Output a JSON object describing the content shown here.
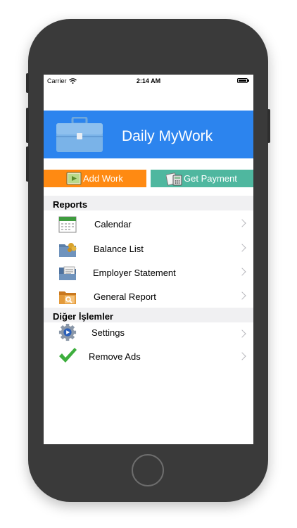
{
  "status_bar": {
    "carrier": "Carrier",
    "time": "2:14 AM"
  },
  "header": {
    "title": "Daily MyWork"
  },
  "actions": {
    "add_work": "Add Work",
    "get_payment": "Get Payment"
  },
  "reports": {
    "heading": "Reports",
    "items": [
      {
        "label": "Calendar",
        "icon": "calendar-icon"
      },
      {
        "label": "Balance List",
        "icon": "folder-coins-icon"
      },
      {
        "label": "Employer Statement",
        "icon": "folder-document-icon"
      },
      {
        "label": "General Report",
        "icon": "folder-search-icon"
      }
    ]
  },
  "other": {
    "heading": "Diğer İşlemler",
    "items": [
      {
        "label": "Settings",
        "icon": "gear-icon"
      },
      {
        "label": "Remove Ads",
        "icon": "checkmark-icon"
      }
    ]
  },
  "colors": {
    "header_blue": "#2c84ee",
    "add_orange": "#ff8a12",
    "payment_green": "#4fb79f"
  }
}
